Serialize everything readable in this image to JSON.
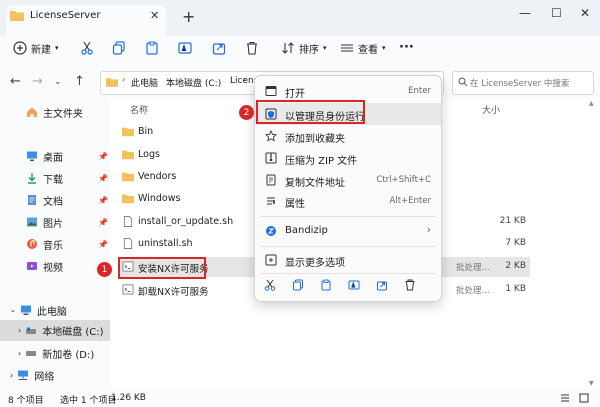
{
  "window": {
    "tab_title": "LicenseServer",
    "close_glyph": "✕",
    "add_glyph": "+",
    "minimize_glyph": "—",
    "maximize_glyph": "☐",
    "window_close_glyph": "✕"
  },
  "toolbar": {
    "new_label": "新建",
    "sort_label": "排序",
    "view_label": "查看",
    "more_glyph": "···"
  },
  "address": {
    "path": [
      "此电脑",
      "本地磁盘 (C:)",
      "Licens"
    ],
    "search_placeholder": "在 LicenseServer 中搜索"
  },
  "sidebar": {
    "home": "主文件夹",
    "quick": [
      {
        "label": "桌面",
        "icon": "desktop-icon"
      },
      {
        "label": "下载",
        "icon": "download-icon"
      },
      {
        "label": "文档",
        "icon": "document-icon"
      },
      {
        "label": "图片",
        "icon": "picture-icon"
      },
      {
        "label": "音乐",
        "icon": "music-icon"
      },
      {
        "label": "视频",
        "icon": "video-icon"
      }
    ],
    "this_pc": "此电脑",
    "drive_c": "本地磁盘 (C:)",
    "drive_d": "新加卷 (D:)",
    "network": "网络"
  },
  "columns": {
    "name": "名称",
    "size": "大小"
  },
  "files": [
    {
      "name": "Bin",
      "kind": "folder",
      "size": "",
      "type": ""
    },
    {
      "name": "Logs",
      "kind": "folder",
      "size": "",
      "type": ""
    },
    {
      "name": "Vendors",
      "kind": "folder",
      "size": "",
      "type": ""
    },
    {
      "name": "Windows",
      "kind": "folder",
      "size": "",
      "type": ""
    },
    {
      "name": "install_or_update.sh",
      "kind": "file",
      "size": "21 KB",
      "type": ""
    },
    {
      "name": "uninstall.sh",
      "kind": "file",
      "size": "7 KB",
      "type": ""
    },
    {
      "name": "安装NX许可服务",
      "kind": "shortcut",
      "size": "2 KB",
      "type": "批处理..."
    },
    {
      "name": "卸载NX许可服务",
      "kind": "shortcut",
      "size": "1 KB",
      "type": "批处理..."
    }
  ],
  "context_menu": {
    "items": [
      {
        "label": "打开",
        "shortcut": "Enter",
        "icon": "open-icon"
      },
      {
        "label": "以管理员身份运行",
        "shortcut": "",
        "icon": "shield-icon"
      },
      {
        "label": "添加到收藏夹",
        "shortcut": "",
        "icon": "star-icon"
      },
      {
        "label": "压缩为 ZIP 文件",
        "shortcut": "",
        "icon": "zip-icon"
      },
      {
        "label": "复制文件地址",
        "shortcut": "Ctrl+Shift+C",
        "icon": "copy-path-icon"
      },
      {
        "label": "属性",
        "shortcut": "Alt+Enter",
        "icon": "properties-icon"
      }
    ],
    "bandizip": "Bandizip",
    "bandizip_arrow": "›",
    "more_options": "显示更多选项"
  },
  "annotations": {
    "badge1": "1",
    "badge2": "2"
  },
  "status": {
    "count": "8 个项目",
    "selection": "选中 1 个项目",
    "size": "1.26 KB"
  },
  "colors": {
    "accent": "#d8262b",
    "folder": "#f2c25c",
    "blue": "#1e6fd9"
  }
}
